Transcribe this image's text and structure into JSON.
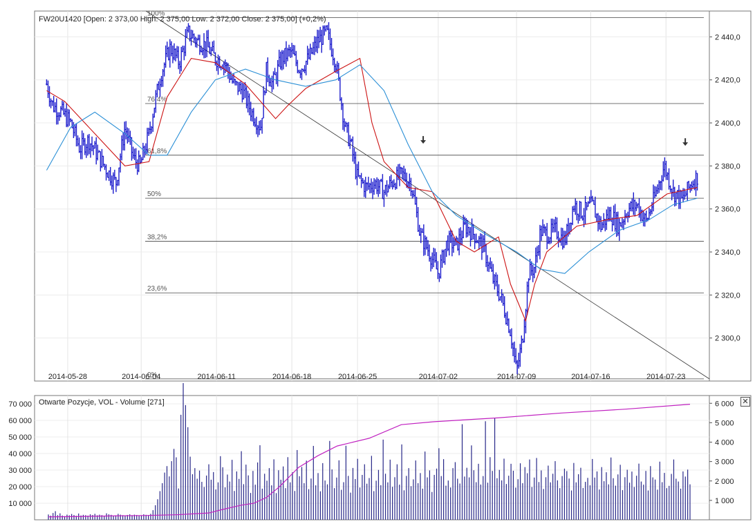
{
  "chart_data": [
    {
      "type": "candlestick",
      "title": "FW20U1420 [Open: 2 373,00  High: 2 375,00  Low: 2 372,00  Close: 2 375,00] (+0,2%)",
      "y_ticks": [
        "2 300,0",
        "2 320,0",
        "2 340,0",
        "2 360,0",
        "2 380,0",
        "2 400,0",
        "2 420,0",
        "2 440,0"
      ],
      "y_tick_values": [
        2300,
        2320,
        2340,
        2360,
        2380,
        2400,
        2420,
        2440
      ],
      "ylim": [
        2280,
        2452
      ],
      "x_ticks": [
        "2014-05-28",
        "2014-06-04",
        "2014-06-11",
        "2014-06-18",
        "2014-06-25",
        "2014-07-02",
        "2014-07-09",
        "2014-07-16",
        "2014-07-23"
      ],
      "x_tick_positions": [
        0.055,
        0.177,
        0.302,
        0.427,
        0.536,
        0.67,
        0.8,
        0.923,
        1.048
      ],
      "x_range": [
        0,
        1.12
      ],
      "fibonacci": [
        {
          "label": "100%",
          "value": 2449
        },
        {
          "label": "76,4%",
          "value": 2409
        },
        {
          "label": "61,8%",
          "value": 2385
        },
        {
          "label": "50%",
          "value": 2365
        },
        {
          "label": "38,2%",
          "value": 2345
        },
        {
          "label": "23,6%",
          "value": 2321
        },
        {
          "label": "0%",
          "value": 2281
        }
      ],
      "trendline": {
        "x": [
          0.185,
          1.12
        ],
        "y": [
          2452,
          2281
        ]
      },
      "arrows": [
        {
          "x": 0.645,
          "y": 2391
        },
        {
          "x": 1.08,
          "y": 2390
        }
      ],
      "price_path": {
        "x": [
          0.02,
          0.03,
          0.045,
          0.06,
          0.075,
          0.09,
          0.105,
          0.12,
          0.135,
          0.15,
          0.165,
          0.175,
          0.19,
          0.2,
          0.21,
          0.225,
          0.24,
          0.255,
          0.27,
          0.285,
          0.3,
          0.315,
          0.33,
          0.345,
          0.36,
          0.375,
          0.385,
          0.395,
          0.41,
          0.425,
          0.44,
          0.455,
          0.47,
          0.485,
          0.5,
          0.515,
          0.525,
          0.535,
          0.55,
          0.565,
          0.58,
          0.595,
          0.61,
          0.625,
          0.64,
          0.655,
          0.67,
          0.685,
          0.7,
          0.715,
          0.73,
          0.745,
          0.76,
          0.775,
          0.79,
          0.8,
          0.81,
          0.82,
          0.83,
          0.84,
          0.85,
          0.865,
          0.88,
          0.895,
          0.91,
          0.925,
          0.94,
          0.955,
          0.97,
          0.985,
          1.0,
          1.015,
          1.03,
          1.045,
          1.06,
          1.075,
          1.09,
          1.1
        ],
        "y": [
          2418,
          2408,
          2405,
          2400,
          2388,
          2392,
          2385,
          2378,
          2372,
          2398,
          2383,
          2380,
          2395,
          2410,
          2423,
          2435,
          2428,
          2442,
          2438,
          2436,
          2430,
          2428,
          2418,
          2415,
          2405,
          2398,
          2425,
          2418,
          2430,
          2433,
          2425,
          2430,
          2438,
          2442,
          2428,
          2398,
          2390,
          2375,
          2370,
          2372,
          2368,
          2373,
          2376,
          2372,
          2348,
          2340,
          2330,
          2345,
          2343,
          2352,
          2348,
          2342,
          2328,
          2318,
          2303,
          2284,
          2300,
          2330,
          2333,
          2350,
          2348,
          2350,
          2345,
          2362,
          2358,
          2362,
          2352,
          2358,
          2352,
          2360,
          2362,
          2354,
          2366,
          2380,
          2368,
          2364,
          2372,
          2375
        ]
      },
      "ema_red": {
        "x": [
          0.02,
          0.05,
          0.1,
          0.15,
          0.19,
          0.22,
          0.26,
          0.3,
          0.35,
          0.4,
          0.42,
          0.45,
          0.5,
          0.54,
          0.56,
          0.58,
          0.62,
          0.66,
          0.7,
          0.73,
          0.77,
          0.79,
          0.815,
          0.83,
          0.85,
          0.9,
          0.95,
          1.0,
          1.05,
          1.1
        ],
        "y": [
          2415,
          2410,
          2395,
          2380,
          2382,
          2412,
          2430,
          2428,
          2418,
          2402,
          2408,
          2416,
          2424,
          2430,
          2400,
          2382,
          2370,
          2368,
          2345,
          2340,
          2347,
          2325,
          2308,
          2325,
          2340,
          2352,
          2355,
          2357,
          2367,
          2370
        ]
      },
      "ema_blue": {
        "x": [
          0.02,
          0.06,
          0.1,
          0.15,
          0.19,
          0.22,
          0.26,
          0.3,
          0.35,
          0.4,
          0.45,
          0.5,
          0.54,
          0.58,
          0.62,
          0.66,
          0.7,
          0.75,
          0.8,
          0.84,
          0.88,
          0.92,
          0.97,
          1.02,
          1.06,
          1.1
        ],
        "y": [
          2378,
          2398,
          2405,
          2395,
          2385,
          2385,
          2405,
          2420,
          2425,
          2420,
          2417,
          2420,
          2427,
          2415,
          2390,
          2368,
          2357,
          2348,
          2340,
          2332,
          2330,
          2340,
          2350,
          2355,
          2362,
          2365
        ]
      }
    },
    {
      "type": "bar",
      "title": "Otwarte Pozycje, VOL - Volume [271]",
      "left_ticks": [
        "10 000",
        "20 000",
        "30 000",
        "40 000",
        "50 000",
        "60 000",
        "70 000"
      ],
      "left_tick_values": [
        10000,
        20000,
        30000,
        40000,
        50000,
        60000,
        70000
      ],
      "right_ticks": [
        "1 000",
        "2 000",
        "3 000",
        "4 000",
        "5 000",
        "6 000"
      ],
      "right_tick_values": [
        1000,
        2000,
        3000,
        4000,
        5000,
        6000
      ],
      "ylim_left": [
        0,
        75000
      ],
      "ylim_right": [
        0,
        6400
      ],
      "volume_series": {
        "name": "VOL",
        "approx_values": [
          3200,
          2500,
          4100,
          5200,
          2800,
          3900,
          2600,
          2200,
          3100,
          2700,
          3500,
          2900,
          2400,
          3800,
          2600,
          3000,
          2800,
          2500,
          3300,
          2900,
          3600,
          2700,
          3100,
          2800,
          2400,
          3900,
          3300,
          3000,
          2500,
          2700,
          3600,
          3100,
          2800,
          2300,
          2900,
          3300,
          2800,
          3100,
          2900,
          2400,
          2600,
          3300,
          3000,
          2800,
          3600,
          5800,
          8800,
          12400,
          17300,
          22100,
          28500,
          32400,
          26200,
          35400,
          42800,
          37700,
          18900,
          63400,
          82500,
          69200,
          55900,
          38100,
          27500,
          31200,
          24800,
          29700,
          22900,
          19800,
          26700,
          33500,
          24200,
          28800,
          18300,
          22600,
          38400,
          31700,
          19600,
          27300,
          23100,
          36200,
          17400,
          29200,
          24700,
          41400,
          21500,
          33300,
          26800,
          16200,
          29500,
          21200,
          34600,
          45000,
          18800,
          27800,
          23600,
          31200,
          20800,
          36500,
          16100,
          29900,
          24200,
          32200,
          19100,
          37800,
          22600,
          28700,
          17400,
          42100,
          26300,
          31900,
          22100,
          35700,
          18500,
          24900,
          44600,
          20800,
          28200,
          17200,
          34200,
          23700,
          21400,
          47600,
          30400,
          19100,
          25500,
          35900,
          18100,
          22700,
          44700,
          26500,
          16400,
          31300,
          24600,
          36800,
          19500,
          27100,
          33500,
          21800,
          25200,
          38600,
          17300,
          23600,
          30100,
          20900,
          48400,
          27800,
          22600,
          36300,
          19900,
          25700,
          33500,
          21200,
          45500,
          17800,
          26500,
          31200,
          20300,
          24400,
          35800,
          22100,
          28200,
          18800,
          41200,
          25600,
          29800,
          16800,
          27100,
          30900,
          43200,
          26400,
          36600,
          20600,
          23700,
          19500,
          31200,
          34800,
          24800,
          21900,
          57700,
          26100,
          31400,
          25600,
          44900,
          29900,
          22700,
          33800,
          21300,
          26400,
          59500,
          22400,
          37800,
          29500,
          61600,
          25100,
          30100,
          23800,
          36900,
          21600,
          26600,
          33800,
          29600,
          19400,
          24500,
          34100,
          22100,
          31800,
          28100,
          36400,
          19800,
          25500,
          37300,
          22800,
          29800,
          18600,
          25700,
          32700,
          22600,
          27800,
          35400,
          23800,
          19100,
          26400,
          30900,
          29400,
          24900,
          17700,
          34300,
          22600,
          27500,
          31400,
          19200,
          22900,
          25300,
          20800,
          36700,
          25500,
          29200,
          18300,
          31800,
          23300,
          28700,
          21400,
          37600,
          25100,
          20600,
          27400,
          33200,
          17900,
          25700,
          30200,
          22400,
          29100,
          19800,
          26600,
          33900,
          23100,
          21200,
          29500,
          17700,
          32400,
          25600,
          24300,
          18200,
          35100,
          22700,
          28300,
          19100,
          20500,
          27700,
          36400,
          24800,
          23100,
          18800,
          29200,
          26100,
          30300,
          21400
        ]
      },
      "open_interest": {
        "name": "Otwarte Pozycje",
        "x": [
          0.0,
          0.05,
          0.1,
          0.15,
          0.2,
          0.25,
          0.27,
          0.3,
          0.32,
          0.34,
          0.36,
          0.39,
          0.42,
          0.45,
          0.5,
          0.55,
          0.6,
          0.65,
          0.7,
          0.8,
          0.9,
          1.0
        ],
        "y": [
          150,
          170,
          200,
          220,
          260,
          350,
          520,
          750,
          850,
          1150,
          1700,
          2700,
          3300,
          3800,
          4200,
          4900,
          5050,
          5150,
          5250,
          5500,
          5700,
          5950
        ]
      }
    }
  ]
}
